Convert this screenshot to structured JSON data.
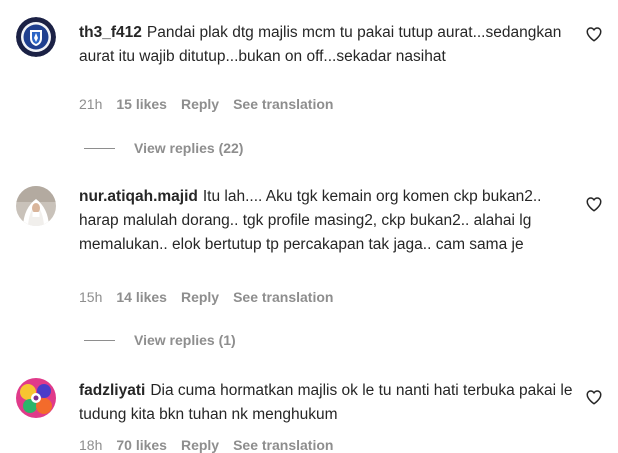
{
  "comments": [
    {
      "username": "th3_f412",
      "text": "Pandai plak dtg majlis mcm tu pakai tutup aurat...sedangkan aurat itu wajib ditutup...bukan on off...sekadar nasihat",
      "time": "21h",
      "likes": "15 likes",
      "reply": "Reply",
      "translate": "See translation",
      "view_replies": "View replies (22)",
      "avatar_icon": "team-crest-avatar"
    },
    {
      "username": "nur.atiqah.majid",
      "text": "Itu lah.... Aku tgk kemain org komen ckp bukan2.. harap malulah dorang.. tgk profile masing2, ckp bukan2.. alahai lg memalukan.. elok bertutup tp percakapan tak jaga.. cam sama je",
      "time": "15h",
      "likes": "14 likes",
      "reply": "Reply",
      "translate": "See translation",
      "view_replies": "View replies (1)",
      "avatar_icon": "hijab-woman-avatar"
    },
    {
      "username": "fadzliyati",
      "text": "Dia cuma hormatkan majlis ok le tu nanti hati terbuka pakai le tudung kita bkn tuhan nk menghukum",
      "time": "18h",
      "likes": "70 likes",
      "reply": "Reply",
      "translate": "See translation",
      "avatar_icon": "colorful-art-avatar"
    }
  ],
  "icons": {
    "like": "heart-icon"
  },
  "colors": {
    "primary_text": "#262626",
    "secondary_text": "#8e8e8e",
    "background": "#ffffff"
  }
}
